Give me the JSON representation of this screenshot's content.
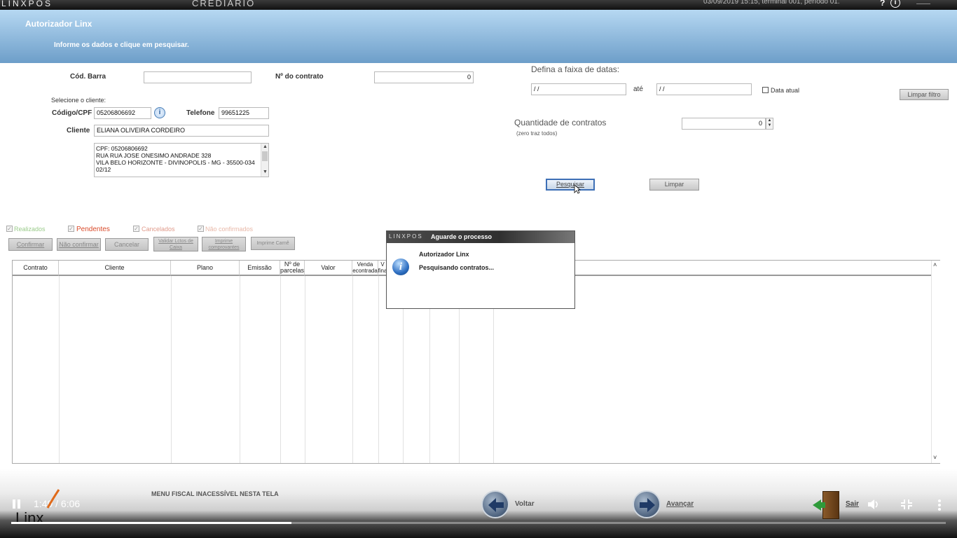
{
  "topbar": {
    "brand": "LINXPOS",
    "module": "CREDIÁRIO",
    "status": "03/09/2019 15:15, terminal 001, período 01.",
    "help": "?",
    "info": "i"
  },
  "header": {
    "title": "Autorizador Linx",
    "subtitle": "Informe os dados e clique em pesquisar."
  },
  "form": {
    "barcode_label": "Cód. Barra",
    "barcode_value": "",
    "contract_label": "Nº do contrato",
    "contract_value": "0",
    "select_client_label": "Selecione o cliente:",
    "code_cpf_label": "Código/CPF",
    "code_cpf_value": "05206806692",
    "phone_label": "Telefone",
    "phone_value": "99651225",
    "client_label": "Cliente",
    "client_value": "ELIANA OLIVEIRA CORDEIRO",
    "details": [
      "CPF: 05206806692",
      "RUA RUA JOSE ONESIMO ANDRADE 328",
      "VILA BELO HORIZONTE - DIVINOPOLIS - MG - 35500-034",
      "02/12"
    ]
  },
  "dates": {
    "range_label": "Defina a faixa de datas:",
    "from_value": " /  /",
    "to_label": "até",
    "to_value": " /  /",
    "current_date_label": "Data atual",
    "clear_filter_button": "Limpar filtro",
    "quantity_label": "Quantidade de contratos",
    "quantity_note": "(zero traz todos)",
    "quantity_value": "0"
  },
  "actions": {
    "search_button": "Pesquisar",
    "clear_button": "Limpar"
  },
  "filters": {
    "realized": "Realizados",
    "pending": "Pendentes",
    "cancelled": "Cancelados",
    "unconfirmed": "Não confirmados"
  },
  "toolbar": {
    "confirm": "Confirmar",
    "not_confirm": "Não confirmar",
    "cancel": "Cancelar",
    "validate_line1": "Validar Lctos de",
    "validate_line2": "Caixa",
    "print_receipts_line1": "Imprime",
    "print_receipts_line2": "comprovantes",
    "print_booklet": "Imprime Carnê"
  },
  "table": {
    "contract": "Contrato",
    "client": "Cliente",
    "plan": "Plano",
    "issue": "Emissão",
    "installments_line1": "Nº de",
    "installments_line2": "parcelas",
    "value": "Valor",
    "sale_line1": "Venda",
    "sale_line2": "econtrada",
    "final_line1": "V",
    "final_line2": "fina"
  },
  "dialog": {
    "brand": "LINXPOS",
    "title": "Aguarde o processo",
    "heading": "Autorizador Linx",
    "message": "Pesquisando contratos..."
  },
  "bottom": {
    "fiscal_menu": "MENU FISCAL INACESSÍVEL NESTA TELA",
    "back": "Voltar",
    "forward": "Avançar",
    "exit": "Sair",
    "time": "1:49 / 6:06",
    "logo": "Linx",
    "progress": 0.3
  }
}
